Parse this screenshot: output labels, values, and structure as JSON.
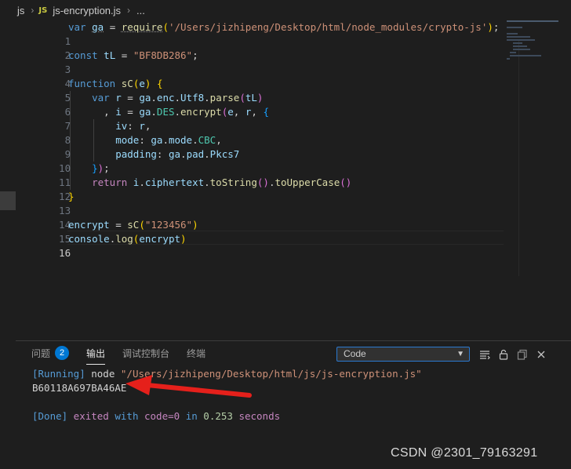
{
  "breadcrumb": {
    "folder": "js",
    "badge": "JS",
    "file": "js-encryption.js",
    "ellipsis": "..."
  },
  "editor": {
    "line_numbers": [
      "1",
      "2",
      "3",
      "4",
      "5",
      "6",
      "7",
      "8",
      "9",
      "10",
      "11",
      "12",
      "13",
      "14",
      "15",
      "16"
    ],
    "active_line": 16,
    "tokens": {
      "l1_var": "var",
      "l1_ga": "ga",
      "l1_eq": " = ",
      "l1_req": "require",
      "l1_path": "'/Users/jizhipeng/Desktop/html/node_modules/crypto-js'",
      "l3_const": "const",
      "l3_tL": "tL",
      "l3_str": "\"BF8DB286\"",
      "l5_function": "function",
      "l5_name": "sC",
      "l5_e": "e",
      "l6_var": "var",
      "l6_r": "r",
      "l6_ga": "ga",
      "l6_enc": "enc",
      "l6_utf8": "Utf8",
      "l6_parse": "parse",
      "l6_tL": "tL",
      "l7_i": "i",
      "l7_ga": "ga",
      "l7_des": "DES",
      "l7_encrypt": "encrypt",
      "l7_e": "e",
      "l7_r": "r",
      "l8_iv": "iv",
      "l8_r": "r",
      "l9_mode": "mode",
      "l9_ga": "ga",
      "l9_modeprop": "mode",
      "l9_cbc": "CBC",
      "l10_padding": "padding",
      "l10_ga": "ga",
      "l10_pad": "pad",
      "l10_pkcs": "Pkcs7",
      "l12_return": "return",
      "l12_i": "i",
      "l12_ct": "ciphertext",
      "l12_ts": "toString",
      "l12_tuc": "toUpperCase",
      "l15_encrypt": "encrypt",
      "l15_sc": "sC",
      "l15_arg": "\"123456\"",
      "l16_console": "console",
      "l16_log": "log",
      "l16_encrypt": "encrypt"
    }
  },
  "panel": {
    "tabs": [
      {
        "label": "问题",
        "badge": "2"
      },
      {
        "label": "输出"
      },
      {
        "label": "调试控制台"
      },
      {
        "label": "终端"
      }
    ],
    "active_tab": "输出",
    "output_channel": "Code",
    "output": {
      "running_tag": "[Running]",
      "running_cmd": " node ",
      "running_path": "\"/Users/jizhipeng/Desktop/html/js/js-encryption.js\"",
      "result": "B60118A697BA46AE",
      "done_tag": "[Done]",
      "done_text1": " exited ",
      "done_with": "with",
      "done_code": " code=0 ",
      "done_in": "in",
      "done_time": " 0.253 ",
      "done_seconds": "seconds"
    }
  },
  "annotation": {
    "arrow_color": "#e5201b"
  },
  "watermark": "CSDN @2301_79163291",
  "icons": [
    "chevron-down-icon",
    "filter-lines-icon",
    "lock-icon",
    "copy-icon",
    "close-icon"
  ]
}
